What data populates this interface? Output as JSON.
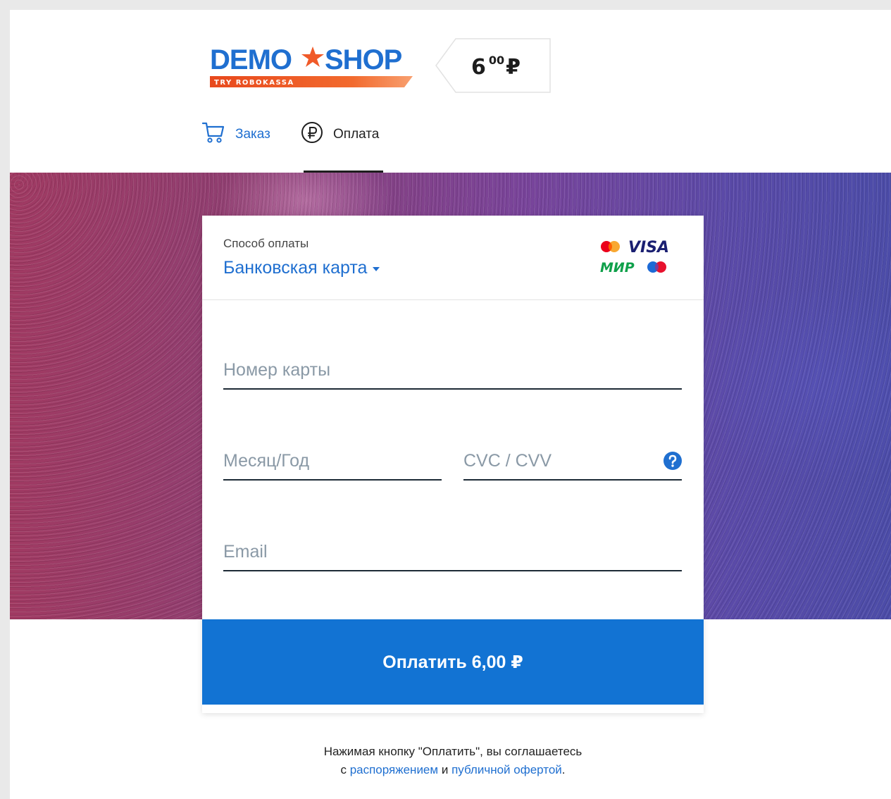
{
  "header": {
    "logo_text_left": "DEMO",
    "logo_text_right": "SHOP",
    "logo_tagline": "TRY ROBOKASSA",
    "price_integer": "6",
    "price_fraction": "00",
    "price_currency": "₽"
  },
  "nav": {
    "tabs": [
      {
        "label": "Заказ",
        "icon": "cart-icon",
        "active": false
      },
      {
        "label": "Оплата",
        "icon": "ruble-circle-icon",
        "active": true
      }
    ]
  },
  "payment": {
    "method_label": "Способ оплаты",
    "method_selected": "Банковская карта",
    "brand_logos": [
      "mastercard-icon",
      "visa-icon",
      "mir-icon",
      "maestro-icon"
    ],
    "fields": {
      "card_number_placeholder": "Номер карты",
      "date_placeholder": "Месяц/Год",
      "cvc_placeholder": "CVC / CVV",
      "email_placeholder": "Email"
    },
    "pay_button_label": "Оплатить 6,00 ₽"
  },
  "footer": {
    "line1": "Нажимая кнопку \"Оплатить\", вы соглашаетесь",
    "line2_prefix": "с",
    "link1": "распоряжением",
    "line2_middle": "и",
    "link2": "публичной офертой",
    "line2_suffix": "."
  },
  "colors": {
    "accent_blue": "#1273d3",
    "link_blue": "#1f6fd0",
    "logo_orange": "#f05a28"
  }
}
